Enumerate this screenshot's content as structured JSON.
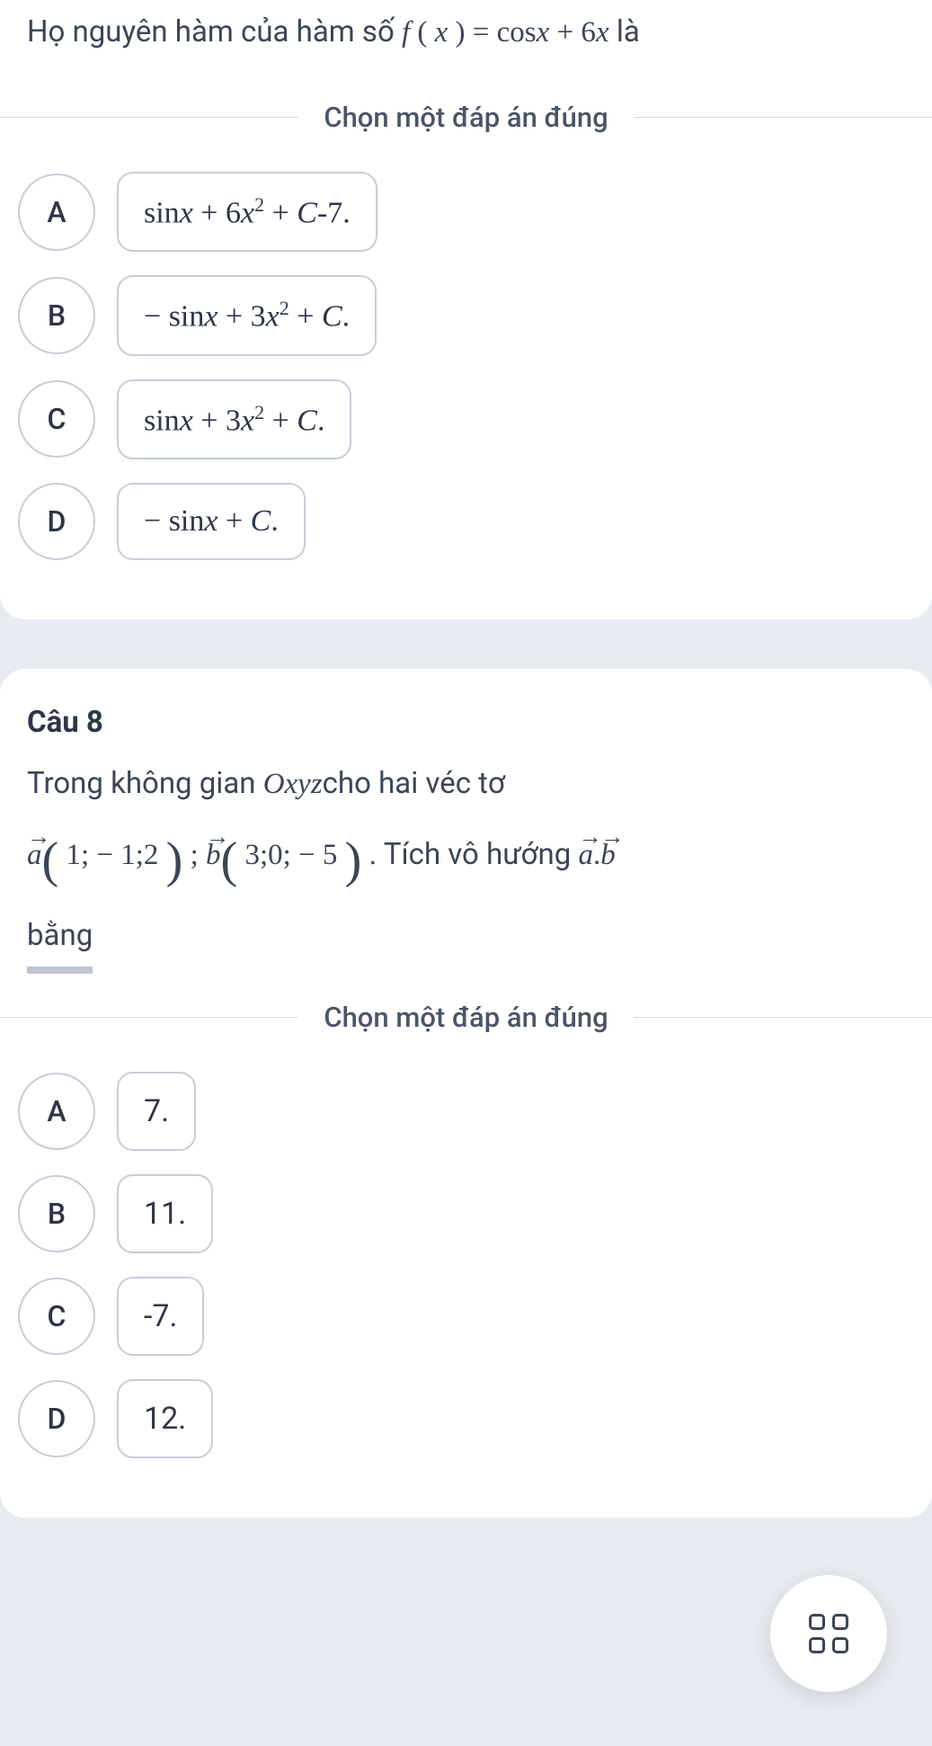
{
  "q7": {
    "prompt_prefix": "Họ nguyên hàm của hàm số ",
    "fn_left": "f",
    "fn_var": "x",
    "eq": " = ",
    "rhs_cos": "cos",
    "rhs_x": "x",
    "rhs_plus": " + 6",
    "rhs_x2": "x",
    "prompt_suffix": " là",
    "choose_label": "Chọn một đáp án đúng",
    "options": {
      "A": {
        "letter": "A",
        "sin": "sin",
        "x": "x",
        "plus1": " + 6",
        "x2": "x",
        "sq": "2",
        "plus2": " + ",
        "C": "C",
        "tail": "-7."
      },
      "B": {
        "letter": "B",
        "neg": "− ",
        "sin": "sin",
        "x": "x",
        "plus1": " + 3",
        "x2": "x",
        "sq": "2",
        "plus2": " + ",
        "C": "C",
        "tail": "."
      },
      "C": {
        "letter": "C",
        "sin": "sin",
        "x": "x",
        "plus1": " + 3",
        "x2": "x",
        "sq": "2",
        "plus2": " + ",
        "C": "C",
        "tail": "."
      },
      "D": {
        "letter": "D",
        "neg": "− ",
        "sin": "sin",
        "x": "x",
        "plus2": " + ",
        "C": "C",
        "tail": "."
      }
    }
  },
  "q8": {
    "label": "Câu 8",
    "line1_prefix": "Trong không gian ",
    "Oxyz": "Oxyz",
    "line1_suffix": "cho hai véc tơ",
    "a": "a",
    "a_coords": " 1; − 1;2 ",
    "semi": " ; ",
    "b": "b",
    "b_coords": " 3;0; − 5 ",
    "dot_prefix": " . Tích vô hướng ",
    "dot_op": ".",
    "bang": "bằng",
    "choose_label": "Chọn một đáp án đúng",
    "options": {
      "A": {
        "letter": "A",
        "text": "7."
      },
      "B": {
        "letter": "B",
        "text": "11."
      },
      "C": {
        "letter": "C",
        "text": "-7."
      },
      "D": {
        "letter": "D",
        "text": "12."
      }
    }
  }
}
